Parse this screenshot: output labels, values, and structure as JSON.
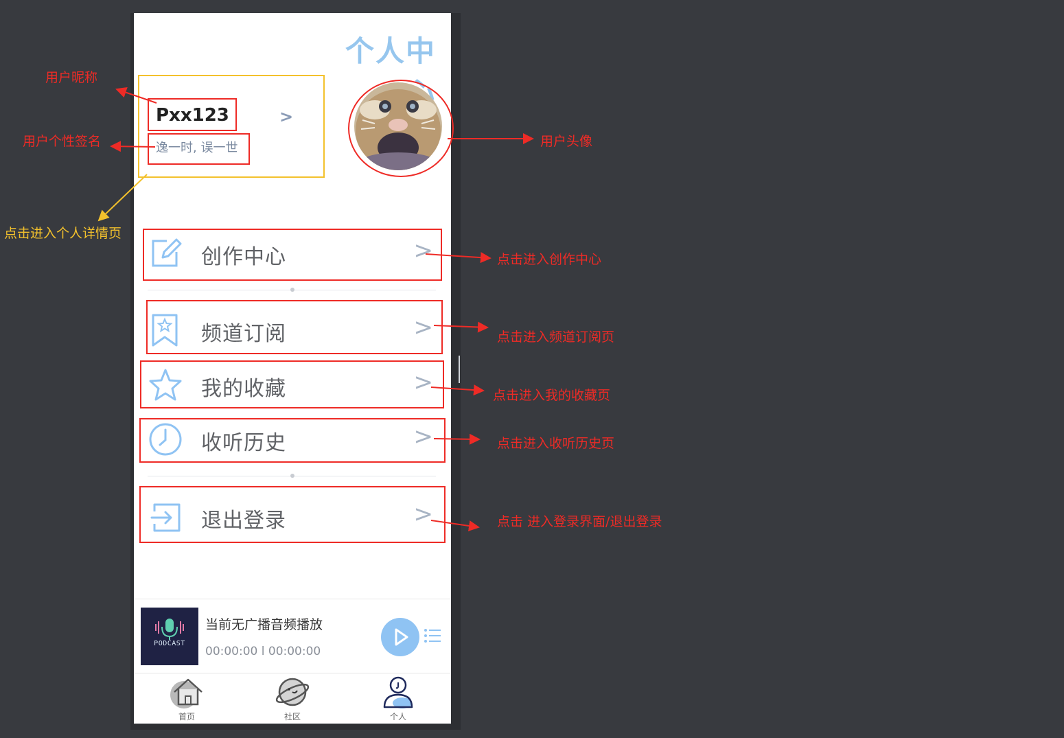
{
  "page": {
    "title": "个人中心"
  },
  "profile": {
    "nickname": "Pxx123",
    "signature": "逸一时, 误一世",
    "arrow": ">"
  },
  "menu": {
    "items": [
      {
        "label": "创作中心",
        "icon": "edit-icon",
        "arrow": ">"
      },
      {
        "label": "频道订阅",
        "icon": "bookmark-star-icon",
        "arrow": ">"
      },
      {
        "label": "我的收藏",
        "icon": "star-icon",
        "arrow": ">"
      },
      {
        "label": "收听历史",
        "icon": "clock-icon",
        "arrow": ">"
      },
      {
        "label": "退出登录",
        "icon": "logout-icon",
        "arrow": ">"
      }
    ]
  },
  "player": {
    "cover_text": "PODCAST",
    "now_playing": "当前无广播音频播放",
    "time": "00:00:00 l 00:00:00"
  },
  "tabbar": {
    "items": [
      {
        "label": "首页",
        "icon": "home-icon"
      },
      {
        "label": "社区",
        "icon": "planet-icon"
      },
      {
        "label": "个人",
        "icon": "person-icon",
        "active": true
      }
    ]
  },
  "annotations": {
    "nickname": "用户昵称",
    "signature": "用户个性签名",
    "profile_detail": "点击进入个人详情页",
    "avatar": "用户头像",
    "creation": "点击进入创作中心",
    "subscribe": "点击进入频道订阅页",
    "favorites": "点击进入我的收藏页",
    "history": "点击进入收听历史页",
    "logout": "点击 进入登录界面/退出登录"
  },
  "colors": {
    "accent": "#96c6ee",
    "annotation_red": "#ee2b26",
    "annotation_yellow": "#f3c12c",
    "background": "#383a3f"
  }
}
